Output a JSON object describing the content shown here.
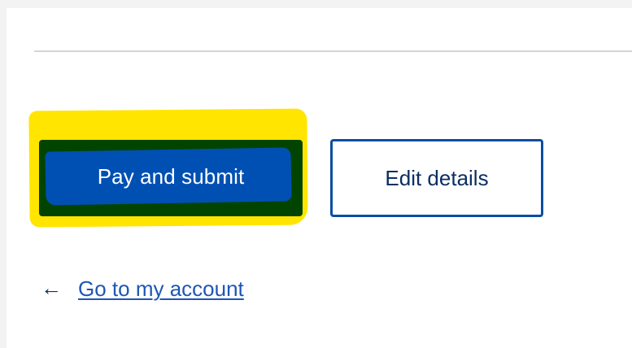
{
  "actions": {
    "primary_label": "Pay and submit",
    "secondary_label": "Edit details"
  },
  "navigation": {
    "back_arrow": "←",
    "back_link_label": "Go to my account",
    "back_arrow_icon": "arrow-left-icon"
  },
  "colors": {
    "page_background": "#f3f3f3",
    "panel_background": "#ffffff",
    "highlight_yellow": "#ffe500",
    "primary_button_dark_green": "#004400",
    "primary_button_blue": "#0050b3",
    "secondary_border_blue": "#0a4ea3",
    "link_blue": "#1d56b6"
  }
}
